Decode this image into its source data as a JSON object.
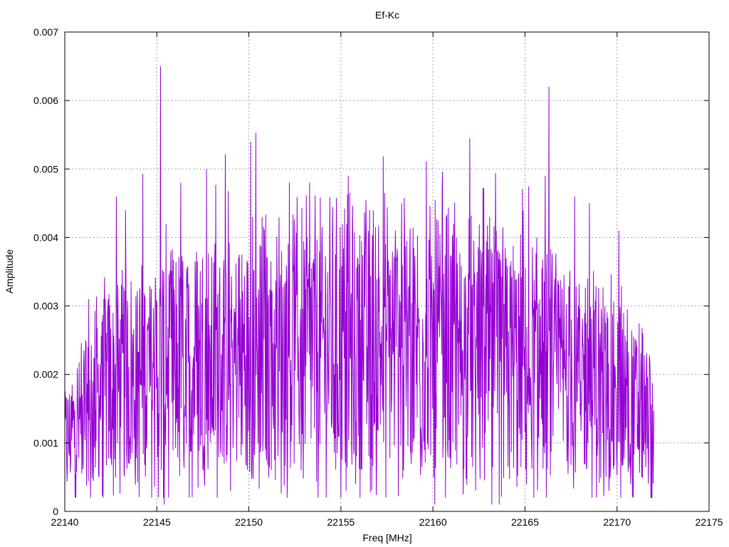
{
  "chart_data": {
    "type": "line",
    "title": "Ef-Kc",
    "xlabel": "Freq [MHz]",
    "ylabel": "Amplitude",
    "xlim": [
      22140,
      22175
    ],
    "ylim": [
      0,
      0.007
    ],
    "xticks": [
      22140,
      22145,
      22150,
      22155,
      22160,
      22165,
      22170,
      22175
    ],
    "yticks": [
      0,
      0.001,
      0.002,
      0.003,
      0.004,
      0.005,
      0.006,
      0.007
    ],
    "xtick_labels": [
      "22140",
      "22145",
      "22150",
      "22155",
      "22160",
      "22165",
      "22170",
      "22175"
    ],
    "ytick_labels": [
      "0",
      "0.001",
      "0.002",
      "0.003",
      "0.004",
      "0.005",
      "0.006",
      "0.007"
    ],
    "grid": true,
    "series": [
      {
        "color": "#9400d3",
        "x_range": [
          22140,
          22172
        ],
        "peaks": [
          {
            "x": 22140.2,
            "y": 0.0011
          },
          {
            "x": 22141.3,
            "y": 0.0031
          },
          {
            "x": 22142.8,
            "y": 0.0046
          },
          {
            "x": 22143.3,
            "y": 0.0044
          },
          {
            "x": 22145.2,
            "y": 0.0065
          },
          {
            "x": 22145.5,
            "y": 0.0042
          },
          {
            "x": 22146.3,
            "y": 0.0048
          },
          {
            "x": 22147.7,
            "y": 0.005
          },
          {
            "x": 22150.1,
            "y": 0.0054
          },
          {
            "x": 22150.2,
            "y": 0.0043
          },
          {
            "x": 22152.2,
            "y": 0.0048
          },
          {
            "x": 22153.3,
            "y": 0.0048
          },
          {
            "x": 22155.4,
            "y": 0.0049
          },
          {
            "x": 22158.3,
            "y": 0.0045
          },
          {
            "x": 22160.5,
            "y": 0.0047
          },
          {
            "x": 22166.3,
            "y": 0.0062
          },
          {
            "x": 22166.1,
            "y": 0.0049
          },
          {
            "x": 22167.7,
            "y": 0.0046
          },
          {
            "x": 22168.5,
            "y": 0.0045
          },
          {
            "x": 22170.1,
            "y": 0.0041
          },
          {
            "x": 22171.4,
            "y": 0.0026
          }
        ],
        "troughs": [
          {
            "x": 22141.4,
            "y": 0.0002
          },
          {
            "x": 22145.4,
            "y": 0.0001
          },
          {
            "x": 22155.0,
            "y": 0.0002
          },
          {
            "x": 22160.1,
            "y": 0.0001
          },
          {
            "x": 22163.2,
            "y": 0.0001
          },
          {
            "x": 22163.6,
            "y": 0.0001
          },
          {
            "x": 22171.9,
            "y": 0.0002
          }
        ]
      }
    ]
  }
}
